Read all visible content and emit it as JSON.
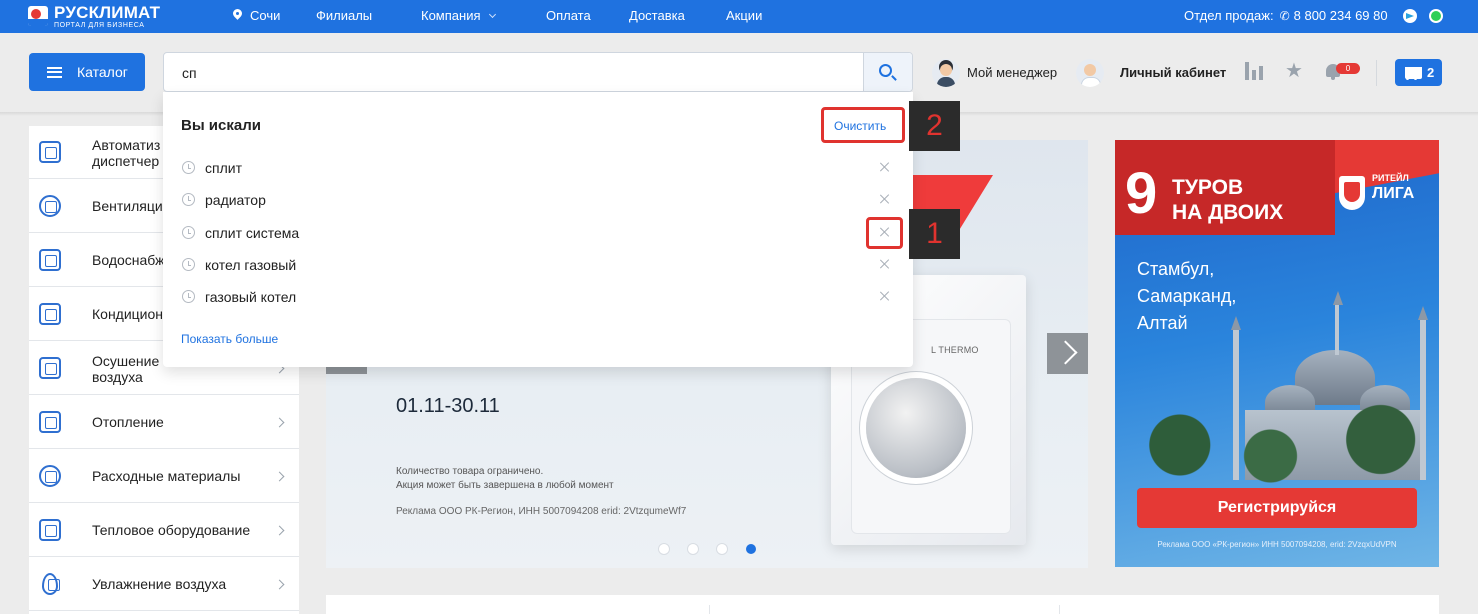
{
  "topbar": {
    "logo_title": "РУСКЛИМАТ",
    "logo_subtitle": "ПОРТАЛ ДЛЯ БИЗНЕСА",
    "city": "Сочи",
    "nav": [
      "Филиалы",
      "Компания",
      "Оплата",
      "Доставка",
      "Акции"
    ],
    "sales_label": "Отдел продаж:",
    "phone": "8 800 234 69 80"
  },
  "header": {
    "catalog_label": "Каталог",
    "search_value": "сп",
    "manager_label": "Мой менеджер",
    "cabinet_label": "Личный кабинет",
    "notifications_count": "0",
    "cart_count": "2"
  },
  "sidebar": {
    "items": [
      {
        "line1": "Автоматиз",
        "line2": "диспетчер"
      },
      {
        "line1": "Вентиляци",
        "line2": ""
      },
      {
        "line1": "Водоснабж",
        "line2": ""
      },
      {
        "line1": "Кондицион",
        "line2": ""
      },
      {
        "line1": "Осушение",
        "line2": "воздуха"
      },
      {
        "line1": "Отопление",
        "line2": ""
      },
      {
        "line1": "Расходные материалы",
        "line2": ""
      },
      {
        "line1": "Тепловое оборудование",
        "line2": ""
      },
      {
        "line1": "Увлажнение воздуха",
        "line2": ""
      }
    ]
  },
  "search_dropdown": {
    "title": "Вы искали",
    "clear_label": "Очистить",
    "history": [
      "сплит",
      "радиатор",
      "сплит система",
      "котел газовый",
      "газовый котел"
    ],
    "show_more": "Показать больше"
  },
  "hero": {
    "device_brand": "L THERMO",
    "date_range": "01.11-30.11",
    "note_line1": "Количество товара ограничено.",
    "note_line2": "Акция может быть завершена в любой момент",
    "ad_line": "Реклама ООО РК-Регион, ИНН 5007094208 erid: 2VtzqumeWf7",
    "slides_total": 4,
    "active_slide": 4
  },
  "promo": {
    "number": "9",
    "tours_line1": "ТУРОВ",
    "tours_line2": "НА ДВОИХ",
    "league_small": "РИТЕЙЛ",
    "league_big": "ЛИГА",
    "cities": [
      "Стамбул,",
      "Самарканд,",
      "Алтай"
    ],
    "button_label": "Регистрируйся",
    "ad_line": "Реклама ООО «РК-регион» ИНН 5007094208, erid: 2VzqxUdVPN"
  },
  "annotations": {
    "marker_1": "1",
    "marker_2": "2"
  },
  "colors": {
    "brand_blue": "#1f72e0",
    "accent_red": "#e0332f"
  }
}
